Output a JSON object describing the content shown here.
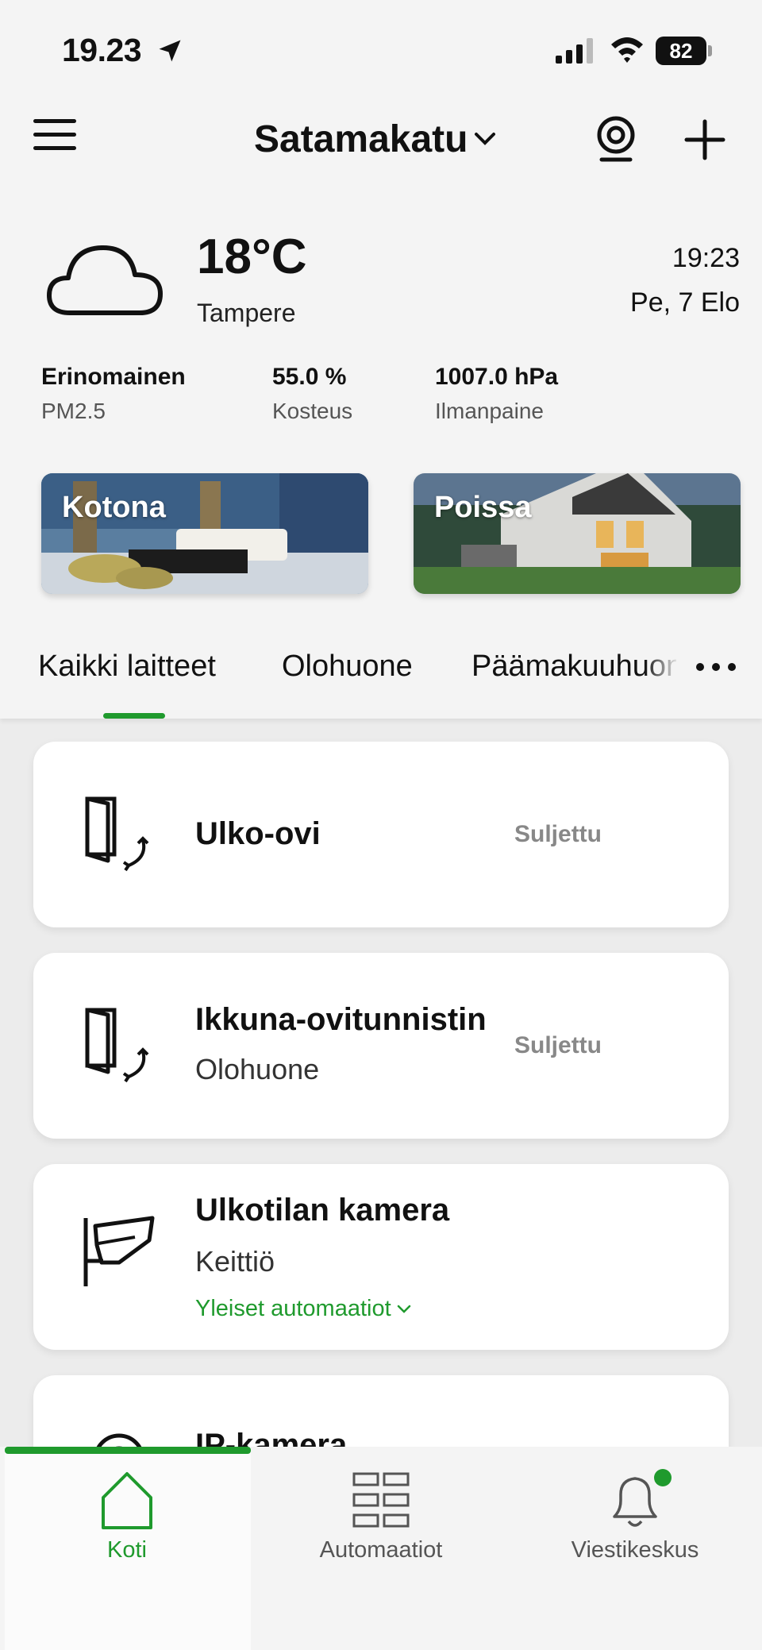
{
  "status_bar": {
    "time": "19.23",
    "battery": "82"
  },
  "header": {
    "home_name": "Satamakatu"
  },
  "weather": {
    "temperature": "18°C",
    "city": "Tampere",
    "time": "19:23",
    "date": "Pe, 7 Elo",
    "stats": [
      {
        "value": "Erinomainen",
        "label": "PM2.5"
      },
      {
        "value": "55.0 %",
        "label": "Kosteus"
      },
      {
        "value": "1007.0 hPa",
        "label": "Ilmanpaine"
      }
    ]
  },
  "scenes": [
    {
      "label": "Kotona"
    },
    {
      "label": "Poissa"
    }
  ],
  "tabs": [
    {
      "label": "Kaikki laitteet",
      "active": true
    },
    {
      "label": "Olohuone"
    },
    {
      "label": "Päämakuuhuone"
    }
  ],
  "devices": [
    {
      "name": "Ulko-ovi",
      "room": "",
      "status": "Suljettu",
      "icon": "door-sensor-icon"
    },
    {
      "name": "Ikkuna-ovitunnistin",
      "room": "Olohuone",
      "status": "Suljettu",
      "icon": "door-sensor-icon"
    },
    {
      "name": "Ulkotilan kamera",
      "room": "Keittiö",
      "link": "Yleiset automaatiot",
      "icon": "security-camera-icon"
    },
    {
      "name": "IP-kamera",
      "icon": "ip-camera-icon"
    }
  ],
  "bottom_nav": [
    {
      "label": "Koti",
      "active": true
    },
    {
      "label": "Automaatiot"
    },
    {
      "label": "Viestikeskus"
    }
  ],
  "colors": {
    "accent": "#1f9a2d"
  }
}
